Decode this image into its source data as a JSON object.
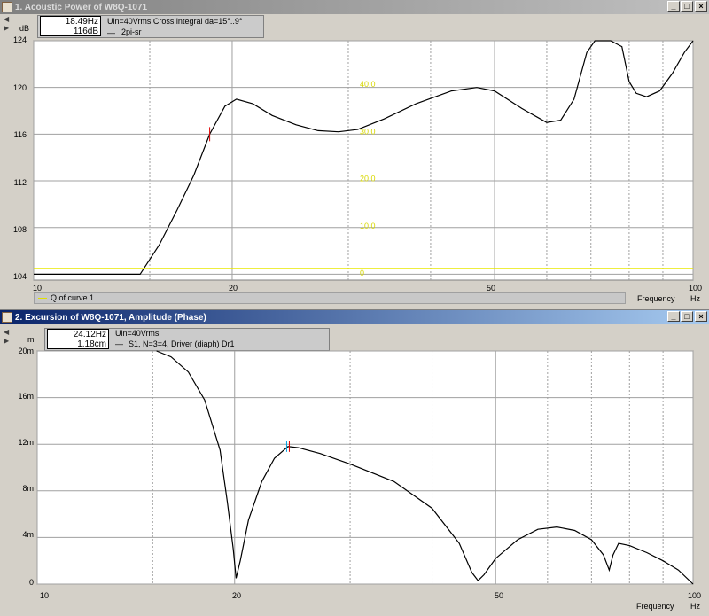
{
  "windows": [
    {
      "title": "1. Acoustic Power of W8Q-1071",
      "active": false,
      "cursor": {
        "freq": "18.49Hz",
        "value": "116dB"
      },
      "legend_line1": "Uin=40Vrms Cross integral da=15°..9°",
      "legend_line2": "2pi-sr",
      "y_unit": "dB",
      "y_ticks": [
        "124",
        "120",
        "116",
        "112",
        "108",
        "104"
      ],
      "x_ticks": [
        "10",
        "20",
        "50",
        "100"
      ],
      "x_label": "Frequency",
      "x_unit": "Hz",
      "secondary_ticks": [
        "40.0",
        "30.0",
        "20.0",
        "10.0",
        "0"
      ],
      "secondary_legend": "Q of curve 1",
      "chart_data": {
        "type": "line",
        "xscale": "log",
        "xlim": [
          10,
          100
        ],
        "ylim": [
          103.5,
          124
        ],
        "grid": true,
        "series": [
          {
            "values": [
              [
                10,
                104
              ],
              [
                14.5,
                104
              ],
              [
                15.5,
                106.5
              ],
              [
                16.5,
                109.5
              ],
              [
                17.5,
                112.5
              ],
              [
                18.49,
                116
              ],
              [
                19.5,
                118.4
              ],
              [
                20.3,
                119
              ],
              [
                21.5,
                118.6
              ],
              [
                23,
                117.6
              ],
              [
                25,
                116.8
              ],
              [
                27,
                116.3
              ],
              [
                29,
                116.2
              ],
              [
                31,
                116.4
              ],
              [
                34,
                117.3
              ],
              [
                38,
                118.6
              ],
              [
                43,
                119.7
              ],
              [
                47,
                120
              ],
              [
                50,
                119.7
              ],
              [
                55,
                118.2
              ],
              [
                60,
                117
              ],
              [
                63,
                117.2
              ],
              [
                66,
                119
              ],
              [
                69,
                123
              ],
              [
                71,
                124
              ],
              [
                75,
                124
              ],
              [
                78,
                123.5
              ],
              [
                80,
                120.5
              ],
              [
                82,
                119.5
              ],
              [
                85,
                119.2
              ],
              [
                89,
                119.7
              ],
              [
                93,
                121.2
              ],
              [
                97,
                123
              ],
              [
                100,
                124
              ]
            ]
          },
          {
            "name": "Q of curve 1",
            "values": [
              [
                10,
                104.5
              ],
              [
                100,
                104.5
              ]
            ]
          }
        ]
      }
    },
    {
      "title": "2. Excursion of W8Q-1071, Amplitude (Phase)",
      "active": true,
      "cursor": {
        "freq": "24.12Hz",
        "value": "1.18cm"
      },
      "legend_line1": "Uin=40Vrms",
      "legend_line2": "S1, N=3=4, Driver (diaph) Dr1",
      "y_unit": "m",
      "y_ticks": [
        "20m",
        "16m",
        "12m",
        "8m",
        "4m",
        "0"
      ],
      "x_ticks": [
        "10",
        "20",
        "50",
        "100"
      ],
      "x_label": "Frequency",
      "x_unit": "Hz",
      "chart_data": {
        "type": "line",
        "xscale": "log",
        "xlim": [
          10,
          100
        ],
        "ylim": [
          0,
          0.02
        ],
        "grid": true,
        "series": [
          {
            "values": [
              [
                15.2,
                0.02
              ],
              [
                16,
                0.0195
              ],
              [
                17,
                0.0182
              ],
              [
                18,
                0.0158
              ],
              [
                19,
                0.0115
              ],
              [
                19.5,
                0.007
              ],
              [
                19.9,
                0.003
              ],
              [
                20.1,
                0.0005
              ],
              [
                20.4,
                0.002
              ],
              [
                21,
                0.0055
              ],
              [
                22,
                0.0088
              ],
              [
                23,
                0.0108
              ],
              [
                24.12,
                0.0118
              ],
              [
                25,
                0.0117
              ],
              [
                27,
                0.0112
              ],
              [
                30,
                0.0103
              ],
              [
                35,
                0.0088
              ],
              [
                40,
                0.0065
              ],
              [
                44,
                0.0035
              ],
              [
                46,
                0.001
              ],
              [
                47,
                0.0003
              ],
              [
                48,
                0.0008
              ],
              [
                50,
                0.0022
              ],
              [
                54,
                0.0038
              ],
              [
                58,
                0.0047
              ],
              [
                62,
                0.0049
              ],
              [
                66,
                0.0046
              ],
              [
                70,
                0.0038
              ],
              [
                73,
                0.0025
              ],
              [
                74.5,
                0.0012
              ],
              [
                75.5,
                0.0025
              ],
              [
                77,
                0.0035
              ],
              [
                80,
                0.0033
              ],
              [
                85,
                0.0027
              ],
              [
                90,
                0.002
              ],
              [
                95,
                0.0012
              ],
              [
                100,
                0
              ]
            ]
          }
        ]
      }
    }
  ]
}
